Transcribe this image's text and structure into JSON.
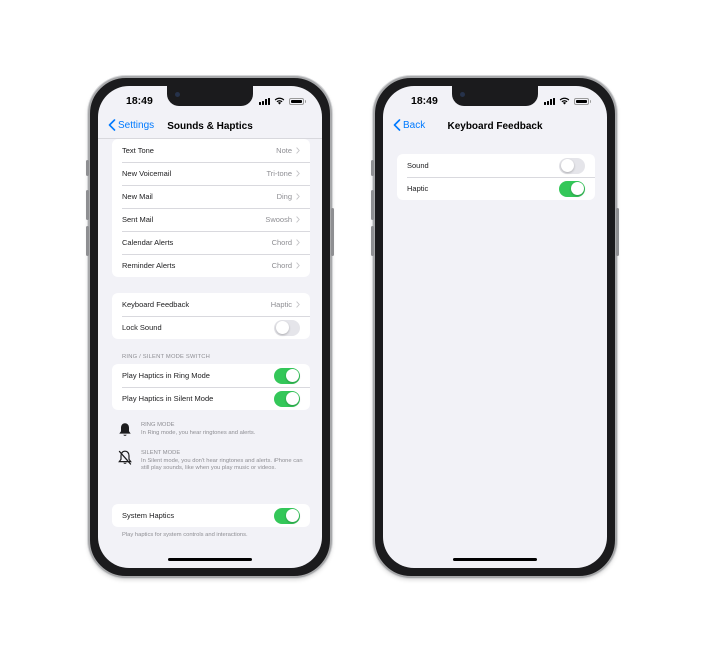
{
  "left_phone": {
    "status_time": "18:49",
    "nav": {
      "back_label": "Settings",
      "title": "Sounds & Haptics"
    },
    "tones": [
      {
        "label": "Text Tone",
        "value": "Note"
      },
      {
        "label": "New Voicemail",
        "value": "Tri-tone"
      },
      {
        "label": "New Mail",
        "value": "Ding"
      },
      {
        "label": "Sent Mail",
        "value": "Swoosh"
      },
      {
        "label": "Calendar Alerts",
        "value": "Chord"
      },
      {
        "label": "Reminder Alerts",
        "value": "Chord"
      }
    ],
    "feedback": {
      "keyboard_label": "Keyboard Feedback",
      "keyboard_value": "Haptic",
      "lock_sound_label": "Lock Sound",
      "lock_sound_on": false
    },
    "ring_silent": {
      "header": "RING / SILENT MODE SWITCH",
      "ring_label": "Play Haptics in Ring Mode",
      "ring_on": true,
      "silent_label": "Play Haptics in Silent Mode",
      "silent_on": true
    },
    "ring_mode": {
      "title": "RING MODE",
      "desc": "In Ring mode, you hear ringtones and alerts.",
      "icon": "bell-icon"
    },
    "silent_mode": {
      "title": "SILENT MODE",
      "desc": "In Silent mode, you don't hear ringtones and alerts. iPhone can still play sounds, like when you play music or videos.",
      "icon": "bell-slash-icon"
    },
    "system_haptics": {
      "label": "System Haptics",
      "on": true,
      "footer": "Play haptics for system controls and interactions."
    }
  },
  "right_phone": {
    "status_time": "18:49",
    "nav": {
      "back_label": "Back",
      "title": "Keyboard Feedback"
    },
    "options": [
      {
        "label": "Sound",
        "on": false
      },
      {
        "label": "Haptic",
        "on": true
      }
    ]
  },
  "colors": {
    "accent": "#007aff",
    "switch_on": "#34c759",
    "switch_off": "#e5e5ea",
    "background": "#f2f2f7",
    "secondary_text": "#8e8e93"
  }
}
